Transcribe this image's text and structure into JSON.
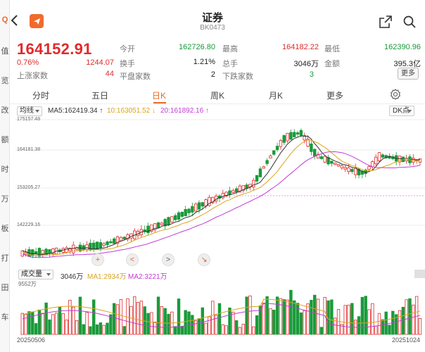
{
  "header": {
    "title": "证券",
    "code": "BK0473"
  },
  "left_strip": [
    "Q",
    "值",
    "览",
    "改",
    "额",
    "时",
    "万",
    "板",
    "打",
    "田",
    "车"
  ],
  "quote": {
    "price": "164152.91",
    "change_pct": "0.76%",
    "change_val": "1244.07",
    "rise_label": "上涨家数",
    "rise_value": "44",
    "open_label": "今开",
    "open_value": "162726.80",
    "high_label": "最高",
    "high_value": "164182.22",
    "low_label": "最低",
    "low_value": "162390.96",
    "turnover_label": "换手",
    "turnover_value": "1.21%",
    "volume_label": "总手",
    "volume_value": "3046万",
    "amount_label": "金额",
    "amount_value": "395.3亿",
    "flat_label": "平盘家数",
    "flat_value": "2",
    "fall_label": "下跌家数",
    "fall_value": "3",
    "more_button": "更多"
  },
  "tabs": [
    "分时",
    "五日",
    "日K",
    "周K",
    "月K",
    "更多"
  ],
  "active_tab": "日K",
  "indicators": {
    "selector": "均线",
    "ma5": "MA5:162419.34",
    "ma10": "10:163051.52",
    "ma20": "20:161892.16",
    "dk_button": "DK点"
  },
  "colors": {
    "up": "#e02b2b",
    "down": "#1a9a3a",
    "ma5": "#333333",
    "ma10": "#d9a51d",
    "ma20": "#c23bd4",
    "accent": "#e8692a"
  },
  "price_axis": [
    "175157.48",
    "164181.38",
    "153205.27",
    "142229.16"
  ],
  "chart_controls": [
    "+",
    "<",
    ">",
    "↘"
  ],
  "volume": {
    "selector": "成交量",
    "value": "3046万",
    "ma1": "MA1:2934万",
    "ma2": "MA2:3221万",
    "max_label": "9552万"
  },
  "dates": {
    "start": "20250506",
    "end": "20251024"
  }
}
